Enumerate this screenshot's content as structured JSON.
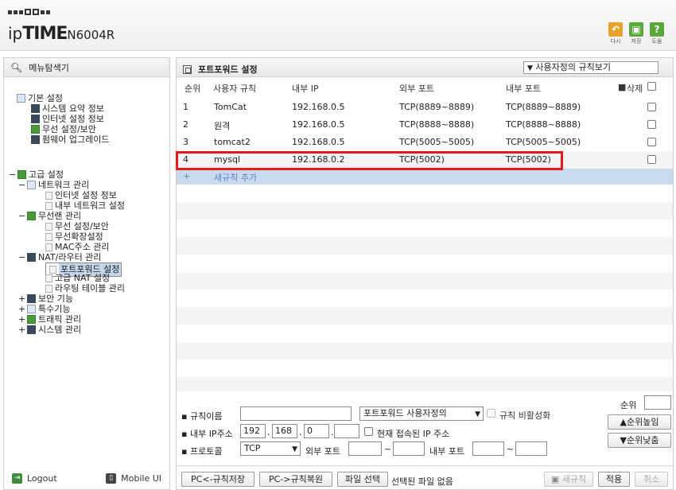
{
  "brand": {
    "logo_ip": "ip",
    "logo_time": "TIME",
    "logo_model": "N6004R"
  },
  "header_buttons": [
    {
      "label": "다시",
      "icon": "undo-icon",
      "color": "#e8a22a"
    },
    {
      "label": "저장",
      "icon": "save-icon",
      "color": "#5aa83a"
    },
    {
      "label": "도움",
      "icon": "help-icon",
      "color": "#5aa83a"
    }
  ],
  "sidebar": {
    "title": "메뉴탐색기",
    "basic": {
      "label": "기본 설정",
      "items": [
        "시스템 요약 정보",
        "인터넷 설정 정보",
        "무선 설정/보안",
        "펌웨어 업그레이드"
      ]
    },
    "advanced": {
      "label": "고급 설정",
      "network": {
        "label": "네트워크 관리",
        "items": [
          "인터넷 설정 정보",
          "내부 네트워크 설정"
        ]
      },
      "wireless": {
        "label": "무선랜 관리",
        "items": [
          "무선 설정/보안",
          "무선확장설정",
          "MAC주소 관리"
        ]
      },
      "nat": {
        "label": "NAT/라우터 관리",
        "items": [
          "포트포워드 설정",
          "고급 NAT 설정",
          "라우팅 테이블 관리"
        ]
      },
      "others": [
        "보안 기능",
        "특수기능",
        "트래픽 관리",
        "시스템 관리"
      ]
    },
    "footer": {
      "logout": "Logout",
      "mobile": "Mobile UI"
    }
  },
  "main": {
    "title": "포트포워드 설정",
    "view_select": "사용자정의 규칙보기",
    "columns": {
      "rank": "순위",
      "rule": "사용자 규칙",
      "internal_ip": "내부 IP",
      "external_port": "외부 포트",
      "internal_port": "내부 포트",
      "delete": "삭제"
    },
    "rows": [
      {
        "num": "1",
        "name": "TomCat",
        "ip": "192.168.0.5",
        "ext": "TCP(8889~8889)",
        "int": "TCP(8889~8889)"
      },
      {
        "num": "2",
        "name": "원격",
        "ip": "192.168.0.5",
        "ext": "TCP(8888~8888)",
        "int": "TCP(8888~8888)"
      },
      {
        "num": "3",
        "name": "tomcat2",
        "ip": "192.168.0.5",
        "ext": "TCP(5005~5005)",
        "int": "TCP(5005~5005)"
      },
      {
        "num": "4",
        "name": "mysql",
        "ip": "192.168.0.2",
        "ext": "TCP(5002)",
        "int": "TCP(5002)"
      }
    ],
    "add_rule": {
      "plus": "+",
      "label": "새규칙 추가"
    }
  },
  "form": {
    "rule_name_label": "규칙이름",
    "rule_name_value": "",
    "template_select": "포트포워드 사용자정의",
    "disable_rule_label": "규칙 비활성화",
    "internal_ip_label": "내부 IP주소",
    "ip": [
      "192",
      "168",
      "0",
      ""
    ],
    "current_ip_label": "현재 접속된 IP 주소",
    "protocol_label": "프로토콜",
    "protocol_value": "TCP",
    "external_port_label": "외부 포트",
    "internal_port_label": "내부 포트",
    "rank_label": "순위",
    "rank_value": "",
    "rank_up": "▲순위높임",
    "rank_down": "▼순위낮춤"
  },
  "footer_buttons": {
    "pc_save": "PC<-규칙저장",
    "pc_restore": "PC->규칙복원",
    "file_select": "파일 선택",
    "no_file": "선택된 파일 없음",
    "new_rule": "새규칙",
    "apply": "적용",
    "cancel": "취소"
  }
}
